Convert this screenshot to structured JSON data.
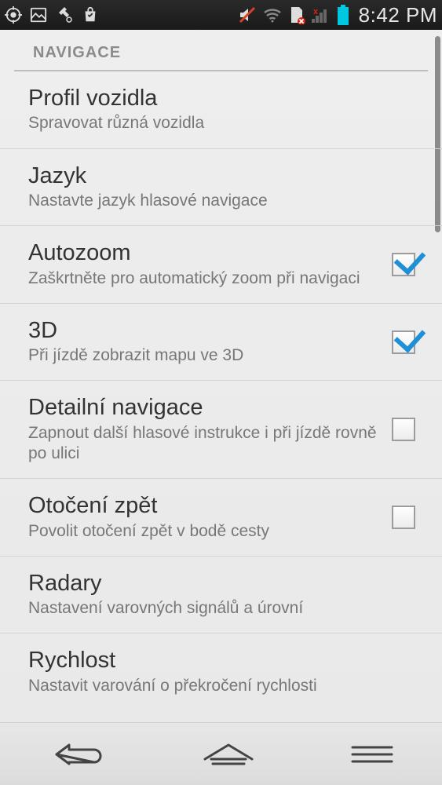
{
  "status": {
    "clock": "8:42 PM"
  },
  "section_header": "NAVIGACE",
  "rows": [
    {
      "title": "Profil vozidla",
      "sub": "Spravovat různá vozidla",
      "checkbox": null
    },
    {
      "title": "Jazyk",
      "sub": "Nastavte jazyk hlasové navigace",
      "checkbox": null
    },
    {
      "title": "Autozoom",
      "sub": "Zaškrtněte pro automatický zoom při navigaci",
      "checkbox": true
    },
    {
      "title": "3D",
      "sub": "Při jízdě zobrazit mapu ve 3D",
      "checkbox": true
    },
    {
      "title": "Detailní navigace",
      "sub": "Zapnout další hlasové instrukce i při jízdě rovně po ulici",
      "checkbox": false
    },
    {
      "title": "Otočení zpět",
      "sub": "Povolit otočení zpět v bodě cesty",
      "checkbox": false
    },
    {
      "title": "Radary",
      "sub": "Nastavení varovných signálů a úrovní",
      "checkbox": null
    },
    {
      "title": "Rychlost",
      "sub": "Nastavit varování o překročení rychlosti",
      "checkbox": null
    }
  ]
}
